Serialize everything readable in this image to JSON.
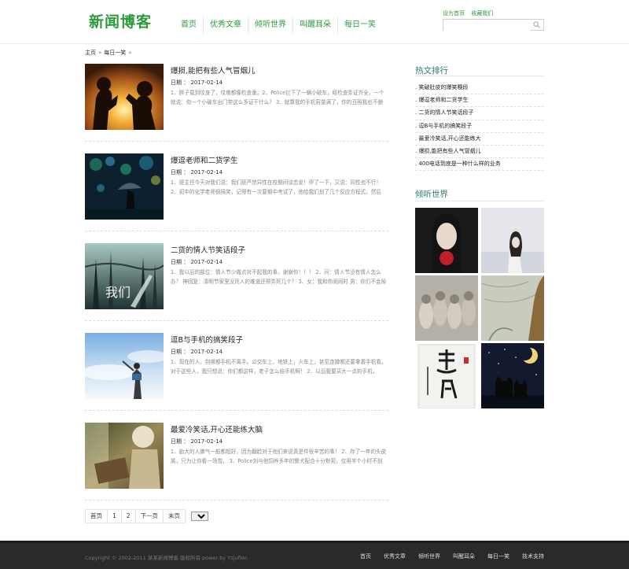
{
  "header": {
    "logo": "新闻博客",
    "nav": [
      "首页",
      "优秀文章",
      "倾听世界",
      "叫醒耳朵",
      "每日一笑"
    ],
    "toplinks": [
      "设为首页",
      "收藏我们"
    ],
    "search_placeholder": ""
  },
  "breadcrumb": {
    "home": "主页",
    "current": "每日一笑",
    "sep": "»"
  },
  "articles": [
    {
      "title": "爆损,能把有些人气冒烟儿",
      "date": "日期 ： 2017-02-14",
      "summary": "1、胖子载到坟身了，坟墩都像检查童。2、Police拦下了一辆小破车，经检查条证齐全，一个就说：你一个小破车出门带这么多证干什么？ 3、就算我的手机容量满了，你的丑照我也不删"
    },
    {
      "title": "爆逗老师和二货学生",
      "date": "日期 ： 2017-02-14",
      "summary": "1、班主任今天对我们说：我们班严禁异性在校期间谈恋爱！停了一下，又说：同性也不行！ 2、初中的化学老师很搞笑，记得有一次要期中考试了，他给我们划了几个反应方程式，然后"
    },
    {
      "title": "二货的情人节笑话段子",
      "date": "日期 ： 2017-02-14",
      "summary": "1、我以后的部位：情人节少做点对不起我的事，谢谢你！！！ 2、问：情人节没有情人怎么办？ 神回复：清明节家里没死人的难道还得弄死几个？ 3、女：我和你闹闹时 男：你们不会掉"
    },
    {
      "title": "逗B与手机的搞笑段子",
      "date": "日期 ： 2017-02-14",
      "summary": "1、现在的人，到哪都手机不离手。公交车上，地铁上，火车上，甚至连蹲都还要拿着手机看。对于这些人，我只想说：你们都这样，老子怎么偷手机啊！ 2、以后我要买大一点的手机，"
    },
    {
      "title": "最爱冷笑话,开心还能练大脑",
      "date": "日期 ： 2017-02-14",
      "summary": "1、胎大的人脾气一般都超好，因为翻脸对于他们来说真是件很辛苦的事！ 2、存了一年的头皮屑，只为让你看一场雪。 3、Police刘与他饲养多年的警犬配合十分默契，仅用半个小时不到"
    }
  ],
  "pager": {
    "items": [
      "首页",
      "1",
      "2",
      "下一页",
      "末页"
    ],
    "select_value": "1"
  },
  "sidebar": {
    "hot_title": "热文排行",
    "hot_items": [
      ". 笑破肚皮的爆笑糗段",
      ". 爆逗老师和二货学生",
      ". 二货的情人节笑话段子",
      ". 逗B与手机的搞笑段子",
      ". 最爱冷笑话,开心还能练大",
      ". 爆损,能把有些人气冒烟儿",
      ". 400电话到底是一种什么样的业务"
    ],
    "listen_title": "倾听世界"
  },
  "footer": {
    "copyright": "Copyright © 2002-2011 某某新闻博客 版权所有 power by Yzjuflen",
    "nav": [
      "首页",
      "优秀文章",
      "倾听世界",
      "叫醒耳朵",
      "每日一笑",
      "技术支持"
    ]
  },
  "colors": {
    "brand_green": "#2a9a3a",
    "sidebar_title": "#2a7a6e",
    "footer_bg": "#2a2a2a"
  }
}
